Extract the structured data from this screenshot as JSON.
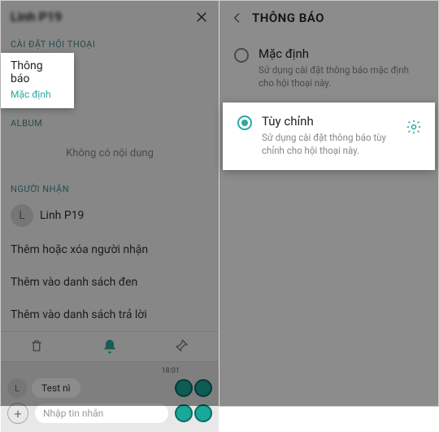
{
  "left": {
    "header_title": "Linh P19",
    "section_conversation": "CÀI ĐẶT HỘI THOẠI",
    "notif_label": "Thông báo",
    "notif_value": "Mặc định",
    "section_album": "ALBUM",
    "album_empty": "Không có nội dung",
    "section_recipient": "NGƯỜI NHẬN",
    "recipient_initial": "L",
    "recipient_name": "Linh P19",
    "actions": [
      "Thêm hoặc xóa người nhận",
      "Thêm vào danh sách đen",
      "Thêm vào danh sách trả lời"
    ],
    "msg_time": "18:01",
    "msg_text": "Test nì",
    "input_placeholder": "Nhập tin nhắn"
  },
  "right": {
    "title": "THÔNG BÁO",
    "options": [
      {
        "title": "Mặc định",
        "desc": "Sử dụng cài đặt thông báo mặc định cho hội thoại này.",
        "selected": false
      },
      {
        "title": "Tùy chỉnh",
        "desc": "Sử dụng cài đặt thông báo tùy chỉnh cho hội thoại này.",
        "selected": true
      }
    ]
  }
}
